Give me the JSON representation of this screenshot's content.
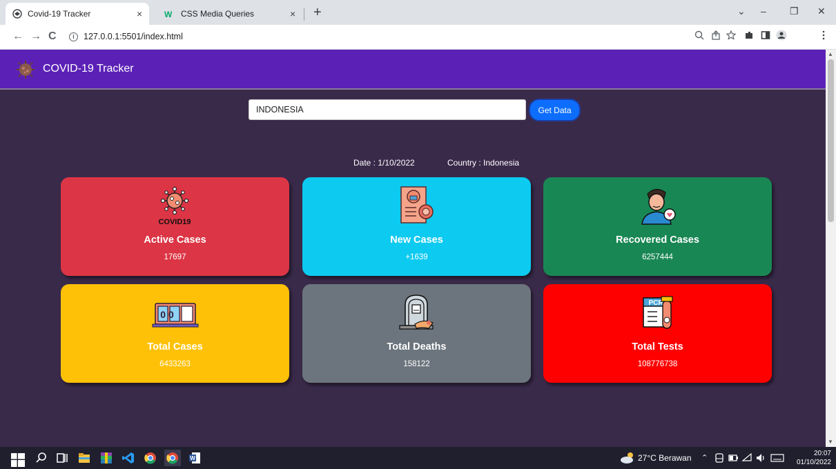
{
  "browser": {
    "tabs": [
      {
        "title": "Covid-19 Tracker",
        "close": "×"
      },
      {
        "title": "CSS Media Queries",
        "close": "×"
      }
    ],
    "new_tab": "+",
    "window_controls": {
      "dropdown": "⌄",
      "minimize": "–",
      "restore": "❐",
      "close": "✕"
    },
    "nav": {
      "back": "←",
      "forward": "→",
      "reload": "C"
    },
    "url": "127.0.0.1:5501/index.html",
    "info": "i"
  },
  "app": {
    "brand": "COVID-19 Tracker",
    "search": {
      "value": "INDONESIA",
      "placeholder": ""
    },
    "button_label": "Get Data",
    "date_label": "Date : 1/10/2022",
    "country_label": "Country : Indonesia"
  },
  "cards": [
    {
      "title": "Active Cases",
      "value": "17697",
      "color": "#dc3545",
      "icon": "virus-icon",
      "icon_text": "COVID19"
    },
    {
      "title": "New Cases",
      "value": "+1639",
      "color": "#0dcaf0",
      "icon": "report-icon"
    },
    {
      "title": "Recovered Cases",
      "value": "6257444",
      "color": "#198754",
      "icon": "recovered-person-icon"
    },
    {
      "title": "Total Cases",
      "value": "6433263",
      "color": "#ffc107",
      "icon": "counter-icon",
      "icon_text": "00"
    },
    {
      "title": "Total Deaths",
      "value": "158122",
      "color": "#6c757d",
      "icon": "tombstone-icon"
    },
    {
      "title": "Total Tests",
      "value": "108776738",
      "color": "#ff0000",
      "icon": "pcr-test-icon",
      "icon_text": "PCR"
    }
  ],
  "taskbar": {
    "weather": "27°C  Berawan",
    "time": "20:07",
    "date": "01/10/2022"
  }
}
